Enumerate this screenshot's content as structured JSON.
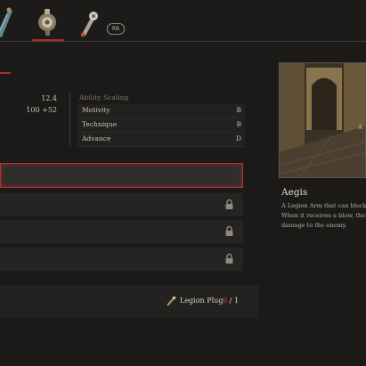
{
  "tabs": [
    {
      "name": "weapon-icon",
      "active": false
    },
    {
      "name": "legion-arm-icon",
      "active": true
    },
    {
      "name": "wrench-arm-icon",
      "active": false
    }
  ],
  "rb_label": "RB",
  "stats": [
    "12.4",
    "100 +52"
  ],
  "ability_scaling": {
    "header": "Ability Scaling",
    "rows": [
      {
        "name": "Motivity",
        "grade": "B"
      },
      {
        "name": "Technique",
        "grade": "B"
      },
      {
        "name": "Advance",
        "grade": "D"
      }
    ]
  },
  "slots": [
    {
      "selected": true,
      "locked": false
    },
    {
      "selected": false,
      "locked": true
    },
    {
      "selected": false,
      "locked": true
    },
    {
      "selected": false,
      "locked": true
    }
  ],
  "upgrade": {
    "material_label": "Legion Plug",
    "have": "0",
    "separator": "/",
    "need": "1"
  },
  "item": {
    "title": "Aegis",
    "description_lines": [
      "A Legion Arm that can block en",
      "When it receives a blow, the emb",
      "damage to the enemy."
    ],
    "preview_letter": "A"
  },
  "colors": {
    "accent_red": "#b42a2a",
    "background": "#1b1a19"
  }
}
